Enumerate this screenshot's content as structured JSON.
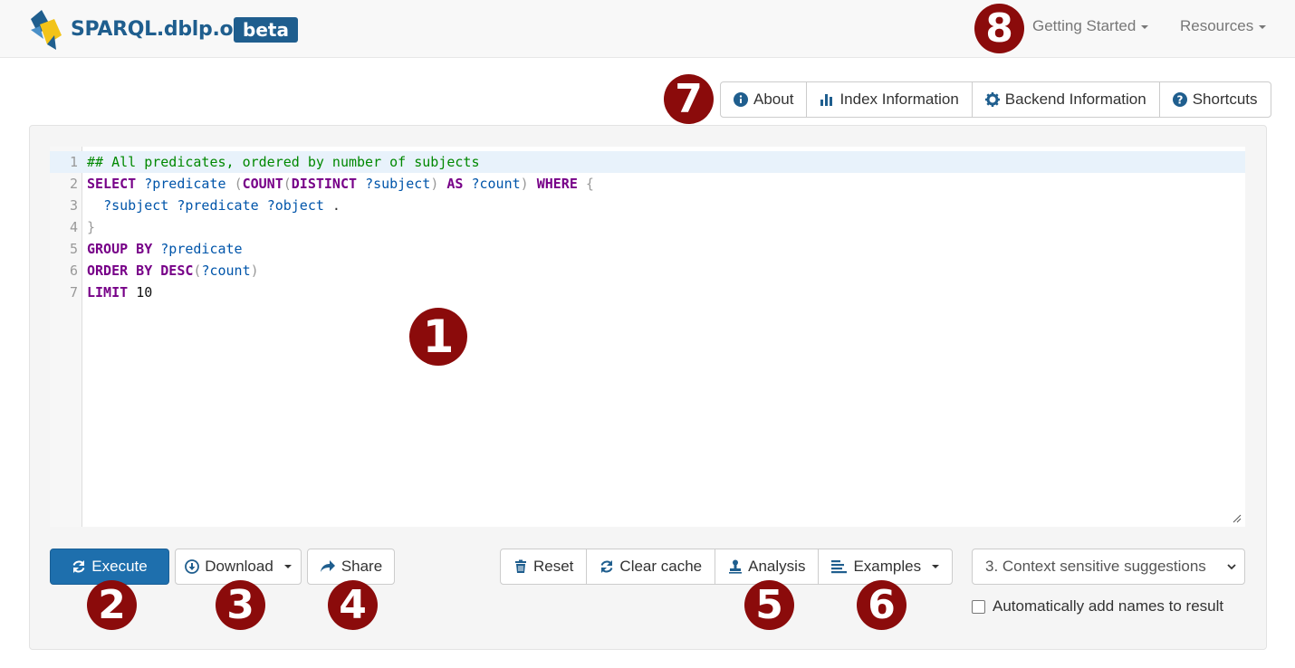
{
  "brand": {
    "name": "SPARQL.dblp.org",
    "tag": "beta"
  },
  "nav": {
    "getting_started": "Getting Started",
    "resources": "Resources"
  },
  "info_buttons": {
    "about": "About",
    "index_information": "Index Information",
    "backend_information": "Backend Information",
    "shortcuts": "Shortcuts"
  },
  "editor": {
    "lines": [
      "## All predicates, ordered by number of subjects",
      "SELECT ?predicate (COUNT(DISTINCT ?subject) AS ?count) WHERE {",
      "  ?subject ?predicate ?object .",
      "}",
      "GROUP BY ?predicate",
      "ORDER BY DESC(?count)",
      "LIMIT 10"
    ],
    "line_numbers": [
      "1",
      "2",
      "3",
      "4",
      "5",
      "6",
      "7"
    ]
  },
  "actions": {
    "execute": "Execute",
    "download": "Download",
    "share": "Share",
    "reset": "Reset",
    "clear_cache": "Clear cache",
    "analysis": "Analysis",
    "examples": "Examples"
  },
  "suggestions": {
    "selected": "3. Context sensitive suggestions"
  },
  "auto_names": {
    "label": "Automatically add names to result",
    "checked": false
  },
  "annotations": [
    "1",
    "2",
    "3",
    "4",
    "5",
    "6",
    "7",
    "8"
  ],
  "colors": {
    "brand_blue": "#1f5e8e",
    "primary_button": "#1e6fad",
    "annotation_badge": "#8b0b0b",
    "keyword": "#770088",
    "variable": "#0055aa",
    "comment": "#008800"
  },
  "icons": {
    "about": "info-circle-icon",
    "index_information": "bar-chart-icon",
    "backend_information": "gear-icon",
    "shortcuts": "question-circle-icon",
    "execute": "refresh-icon",
    "download": "download-circle-icon",
    "share": "share-arrow-icon",
    "reset": "trash-icon",
    "clear_cache": "refresh-icon",
    "analysis": "stamp-icon",
    "examples": "list-icon"
  }
}
